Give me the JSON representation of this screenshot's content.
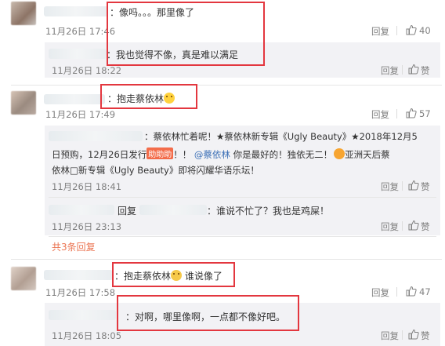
{
  "comments": [
    {
      "id": "c1",
      "text": "：像吗。。。那里像了",
      "time": "11月26日 17:46",
      "reply_label": "回复",
      "likes": "40"
    },
    {
      "id": "c1r1",
      "text": "：我也觉得不像，真是难以满足",
      "time": "11月26日 18:22",
      "reply_label": "回复",
      "like_label": "赞"
    },
    {
      "id": "c2",
      "text": "：抱走蔡依林",
      "time": "11月26日 17:49",
      "reply_label": "回复",
      "likes": "57"
    },
    {
      "id": "c2r1",
      "line1": "：蔡依林忙着呢！★蔡依林新专辑《Ugly Beauty》★2018年12月5",
      "line2a": "日预购，12月26日发行",
      "badge": "助助助",
      "line2b": "！！",
      "mention": "@蔡依林",
      "line2c": "你是最好的！独依无二！",
      "line2d": "亚洲天后蔡",
      "line3": "依林□新专辑《Ugly Beauty》即将闪耀华语乐坛！",
      "time": "11月26日 18:41",
      "reply_label": "回复",
      "like_label": "赞"
    },
    {
      "id": "c2r2",
      "prefix": "回复",
      "text": "：谁说不忙了？我也是鸡屎！",
      "time": "11月26日 23:13",
      "reply_label": "回复",
      "like_label": "赞"
    },
    {
      "id": "c3",
      "text_a": "：抱走蔡依林",
      "text_b": "谁说像了",
      "time": "11月26日 17:58",
      "reply_label": "回复",
      "likes": "47"
    },
    {
      "id": "c3r1",
      "text": "：对啊，哪里像啊，一点都不像好吧。",
      "time": "11月26日 18:05",
      "reply_label": "回复",
      "like_label": "赞"
    }
  ],
  "more_replies": "共3条回复",
  "icons": {
    "like": "thumbs-up-icon",
    "emoji_smile": "smile-emoji-icon",
    "emoji_lion": "lion-emoji-icon",
    "emoji_thumb": "thumb-emoji-icon"
  },
  "colors": {
    "highlight": "#e3373f",
    "link": "#eb7350",
    "mention": "#3b6fb6",
    "muted": "#808080"
  }
}
